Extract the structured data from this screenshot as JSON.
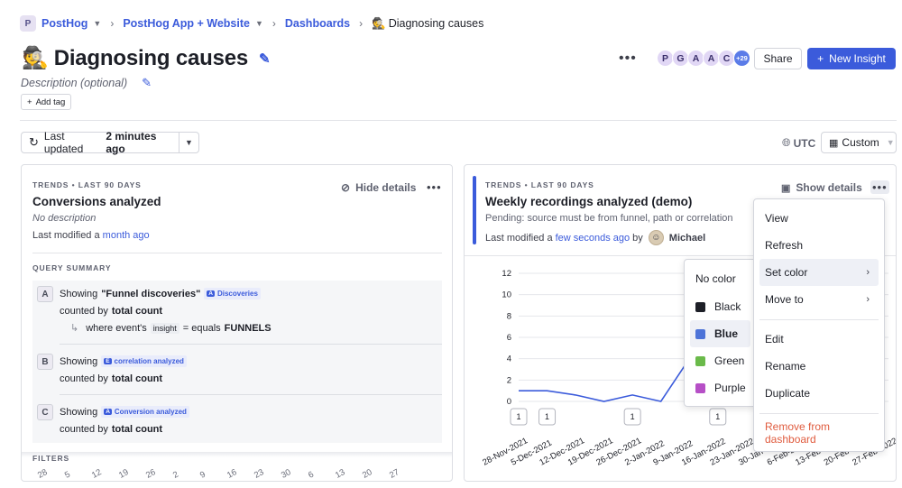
{
  "breadcrumb": {
    "workspace_badge": "P",
    "org": "PostHog",
    "project": "PostHog App + Website",
    "section": "Dashboards",
    "current_emoji": "🕵️",
    "current": "Diagnosing causes"
  },
  "header": {
    "emoji": "🕵️",
    "title": "Diagnosing causes",
    "description_placeholder": "Description (optional)",
    "add_tag": "Add tag",
    "avatars": [
      "P",
      "G",
      "A",
      "A",
      "C"
    ],
    "avatars_more": "+29",
    "share_label": "Share",
    "new_insight_label": "New Insight"
  },
  "toolbar": {
    "last_updated_prefix": "Last updated",
    "last_updated_value": "2 minutes ago",
    "timezone": "UTC",
    "date_range": "Custom"
  },
  "card1": {
    "kicker": "TRENDS • LAST 90 DAYS",
    "title": "Conversions analyzed",
    "description": "No description",
    "modified_prefix": "Last modified a",
    "modified_value": "month ago",
    "hide_details": "Hide details",
    "query_summary": "QUERY SUMMARY",
    "filters_label": "FILTERS",
    "series": [
      {
        "letter": "A",
        "showing": "Showing",
        "event_name": "\"Funnel discoveries\"",
        "tag_icon": "A",
        "tag": "Discoveries",
        "counted_prefix": "counted by",
        "counted": "total count",
        "where_prefix": "where event's",
        "where_prop": "insight",
        "where_op": "= equals",
        "where_value": "FUNNELS"
      },
      {
        "letter": "B",
        "showing": "Showing",
        "tag_icon": "E",
        "tag": "correlation analyzed",
        "counted_prefix": "counted by",
        "counted": "total count"
      },
      {
        "letter": "C",
        "showing": "Showing",
        "tag_icon": "A",
        "tag": "Conversion analyzed",
        "counted_prefix": "counted by",
        "counted": "total count"
      }
    ],
    "bg_axis_labels": [
      "28",
      "5",
      "12",
      "19",
      "26",
      "2",
      "9",
      "16",
      "23",
      "30",
      "6",
      "13",
      "20",
      "27"
    ]
  },
  "card2": {
    "kicker": "TRENDS • LAST 90 DAYS",
    "title": "Weekly recordings analyzed (demo)",
    "pending": "Pending: source must be from funnel, path or correlation",
    "modified_prefix": "Last modified a",
    "modified_value": "few seconds ago",
    "modified_by": "by",
    "author": "Michael",
    "show_details": "Show details"
  },
  "chart_data": {
    "type": "line",
    "x": [
      "28-Nov-2021",
      "5-Dec-2021",
      "12-Dec-2021",
      "19-Dec-2021",
      "26-Dec-2021",
      "2-Jan-2022",
      "9-Jan-2022",
      "16-Jan-2022",
      "23-Jan-2022",
      "30-Jan-2022",
      "6-Feb-2022",
      "13-Feb-2022",
      "20-Feb-2022",
      "27-Feb-2022"
    ],
    "series": [
      {
        "values": [
          1,
          1,
          0.6,
          0,
          0.6,
          0,
          4,
          1
        ]
      }
    ],
    "ylim": [
      0,
      12
    ],
    "yticks": [
      0,
      2,
      4,
      6,
      8,
      10,
      12
    ],
    "annotation_counts": [
      "1",
      "1",
      "1",
      "1"
    ],
    "color": "#3b5bdb"
  },
  "context_menu": {
    "items": [
      {
        "label": "View"
      },
      {
        "label": "Refresh"
      },
      {
        "label": "Set color"
      },
      {
        "label": "Move to"
      },
      {
        "label": "Edit"
      },
      {
        "label": "Rename"
      },
      {
        "label": "Duplicate"
      },
      {
        "label": "Remove from dashboard"
      }
    ]
  },
  "color_submenu": {
    "items": [
      {
        "label": "No color",
        "color": ""
      },
      {
        "label": "Black",
        "color": "#1d1f27"
      },
      {
        "label": "Blue",
        "color": "#4d73d8"
      },
      {
        "label": "Green",
        "color": "#6aba4a"
      },
      {
        "label": "Purple",
        "color": "#b64fc6"
      }
    ]
  }
}
